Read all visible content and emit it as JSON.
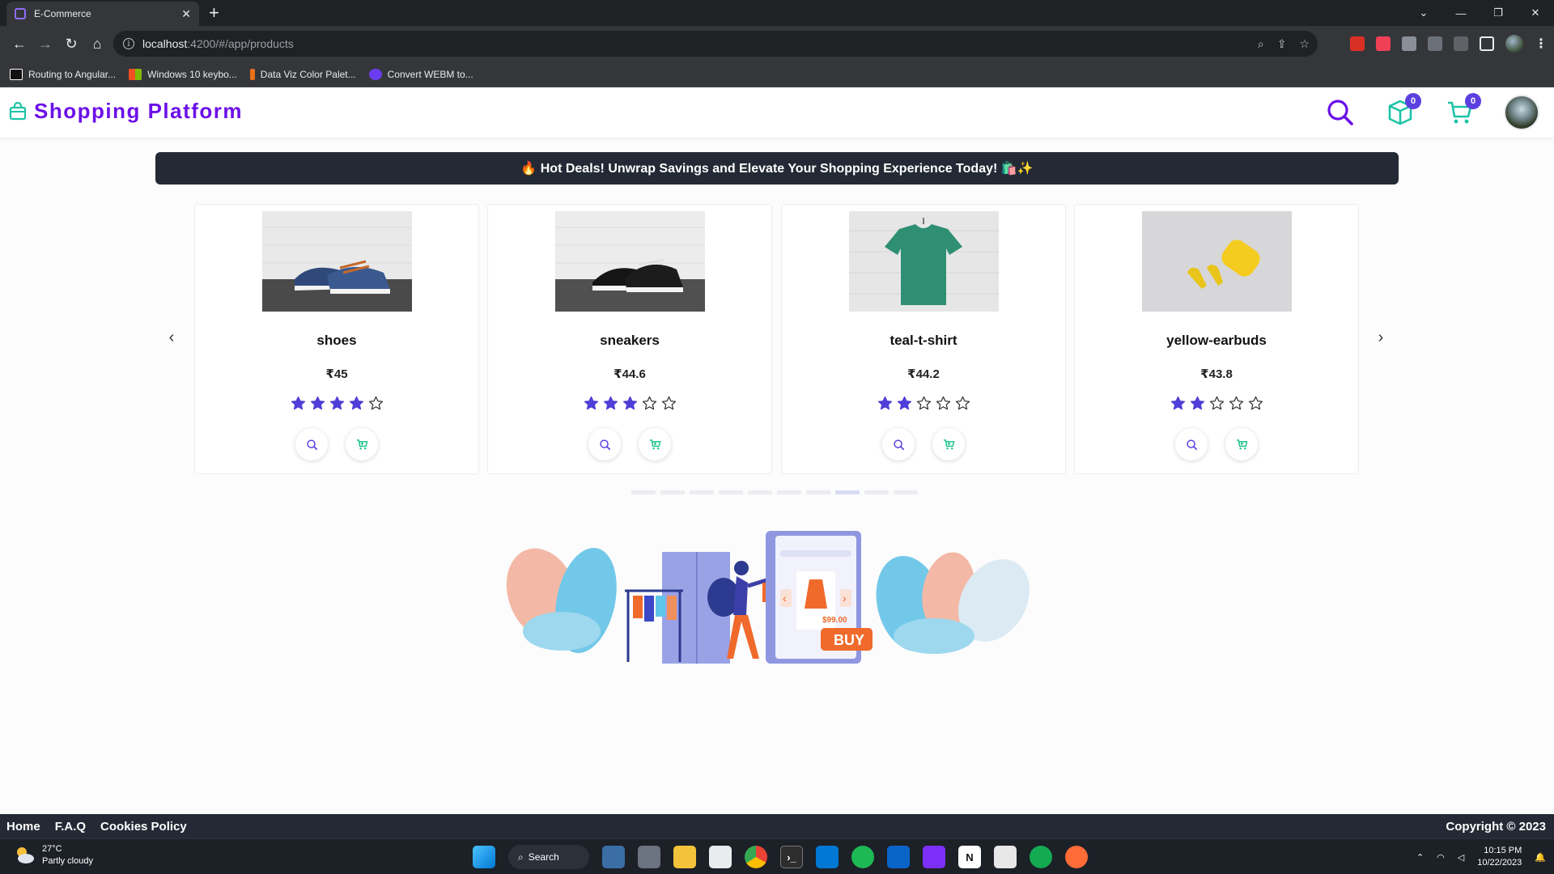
{
  "browser": {
    "tab_title": "E-Commerce",
    "url_host": "localhost",
    "url_rest": ":4200/#/app/products",
    "bookmarks": [
      {
        "label": "Routing to Angular...",
        "color": "#111111"
      },
      {
        "label": "Windows 10 keybo...",
        "color": "#f25022"
      },
      {
        "label": "Data Viz Color Palet...",
        "color": "#e8711a"
      },
      {
        "label": "Convert WEBM to...",
        "color": "#6a3df0"
      }
    ]
  },
  "header": {
    "brand": "Shopping Platform",
    "orders_count": "0",
    "cart_count": "0"
  },
  "banner": {
    "text": "🔥 Hot Deals! Unwrap Savings and Elevate Your Shopping Experience Today! 🛍️✨"
  },
  "products": [
    {
      "name": "shoes",
      "price": "₹45",
      "rating": 4
    },
    {
      "name": "sneakers",
      "price": "₹44.6",
      "rating": 3
    },
    {
      "name": "teal-t-shirt",
      "price": "₹44.2",
      "rating": 2
    },
    {
      "name": "yellow-earbuds",
      "price": "₹43.8",
      "rating": 2
    }
  ],
  "carousel": {
    "indicator_count": 10,
    "active_index": 7
  },
  "illustration": {
    "price_tag": "$99.00",
    "buy_label": "BUY"
  },
  "footer": {
    "links": [
      "Home",
      "F.A.Q",
      "Cookies Policy"
    ],
    "copyright": "Copyright © 2023"
  },
  "taskbar": {
    "temperature": "27°C",
    "weather": "Partly cloudy",
    "search_label": "Search",
    "time": "10:15 PM",
    "date": "10/22/2023"
  },
  "colors": {
    "brand": "#6b10e8",
    "accent": "#5b3fe0",
    "teal": "#1cc4a6",
    "banner_bg": "#232a35"
  }
}
